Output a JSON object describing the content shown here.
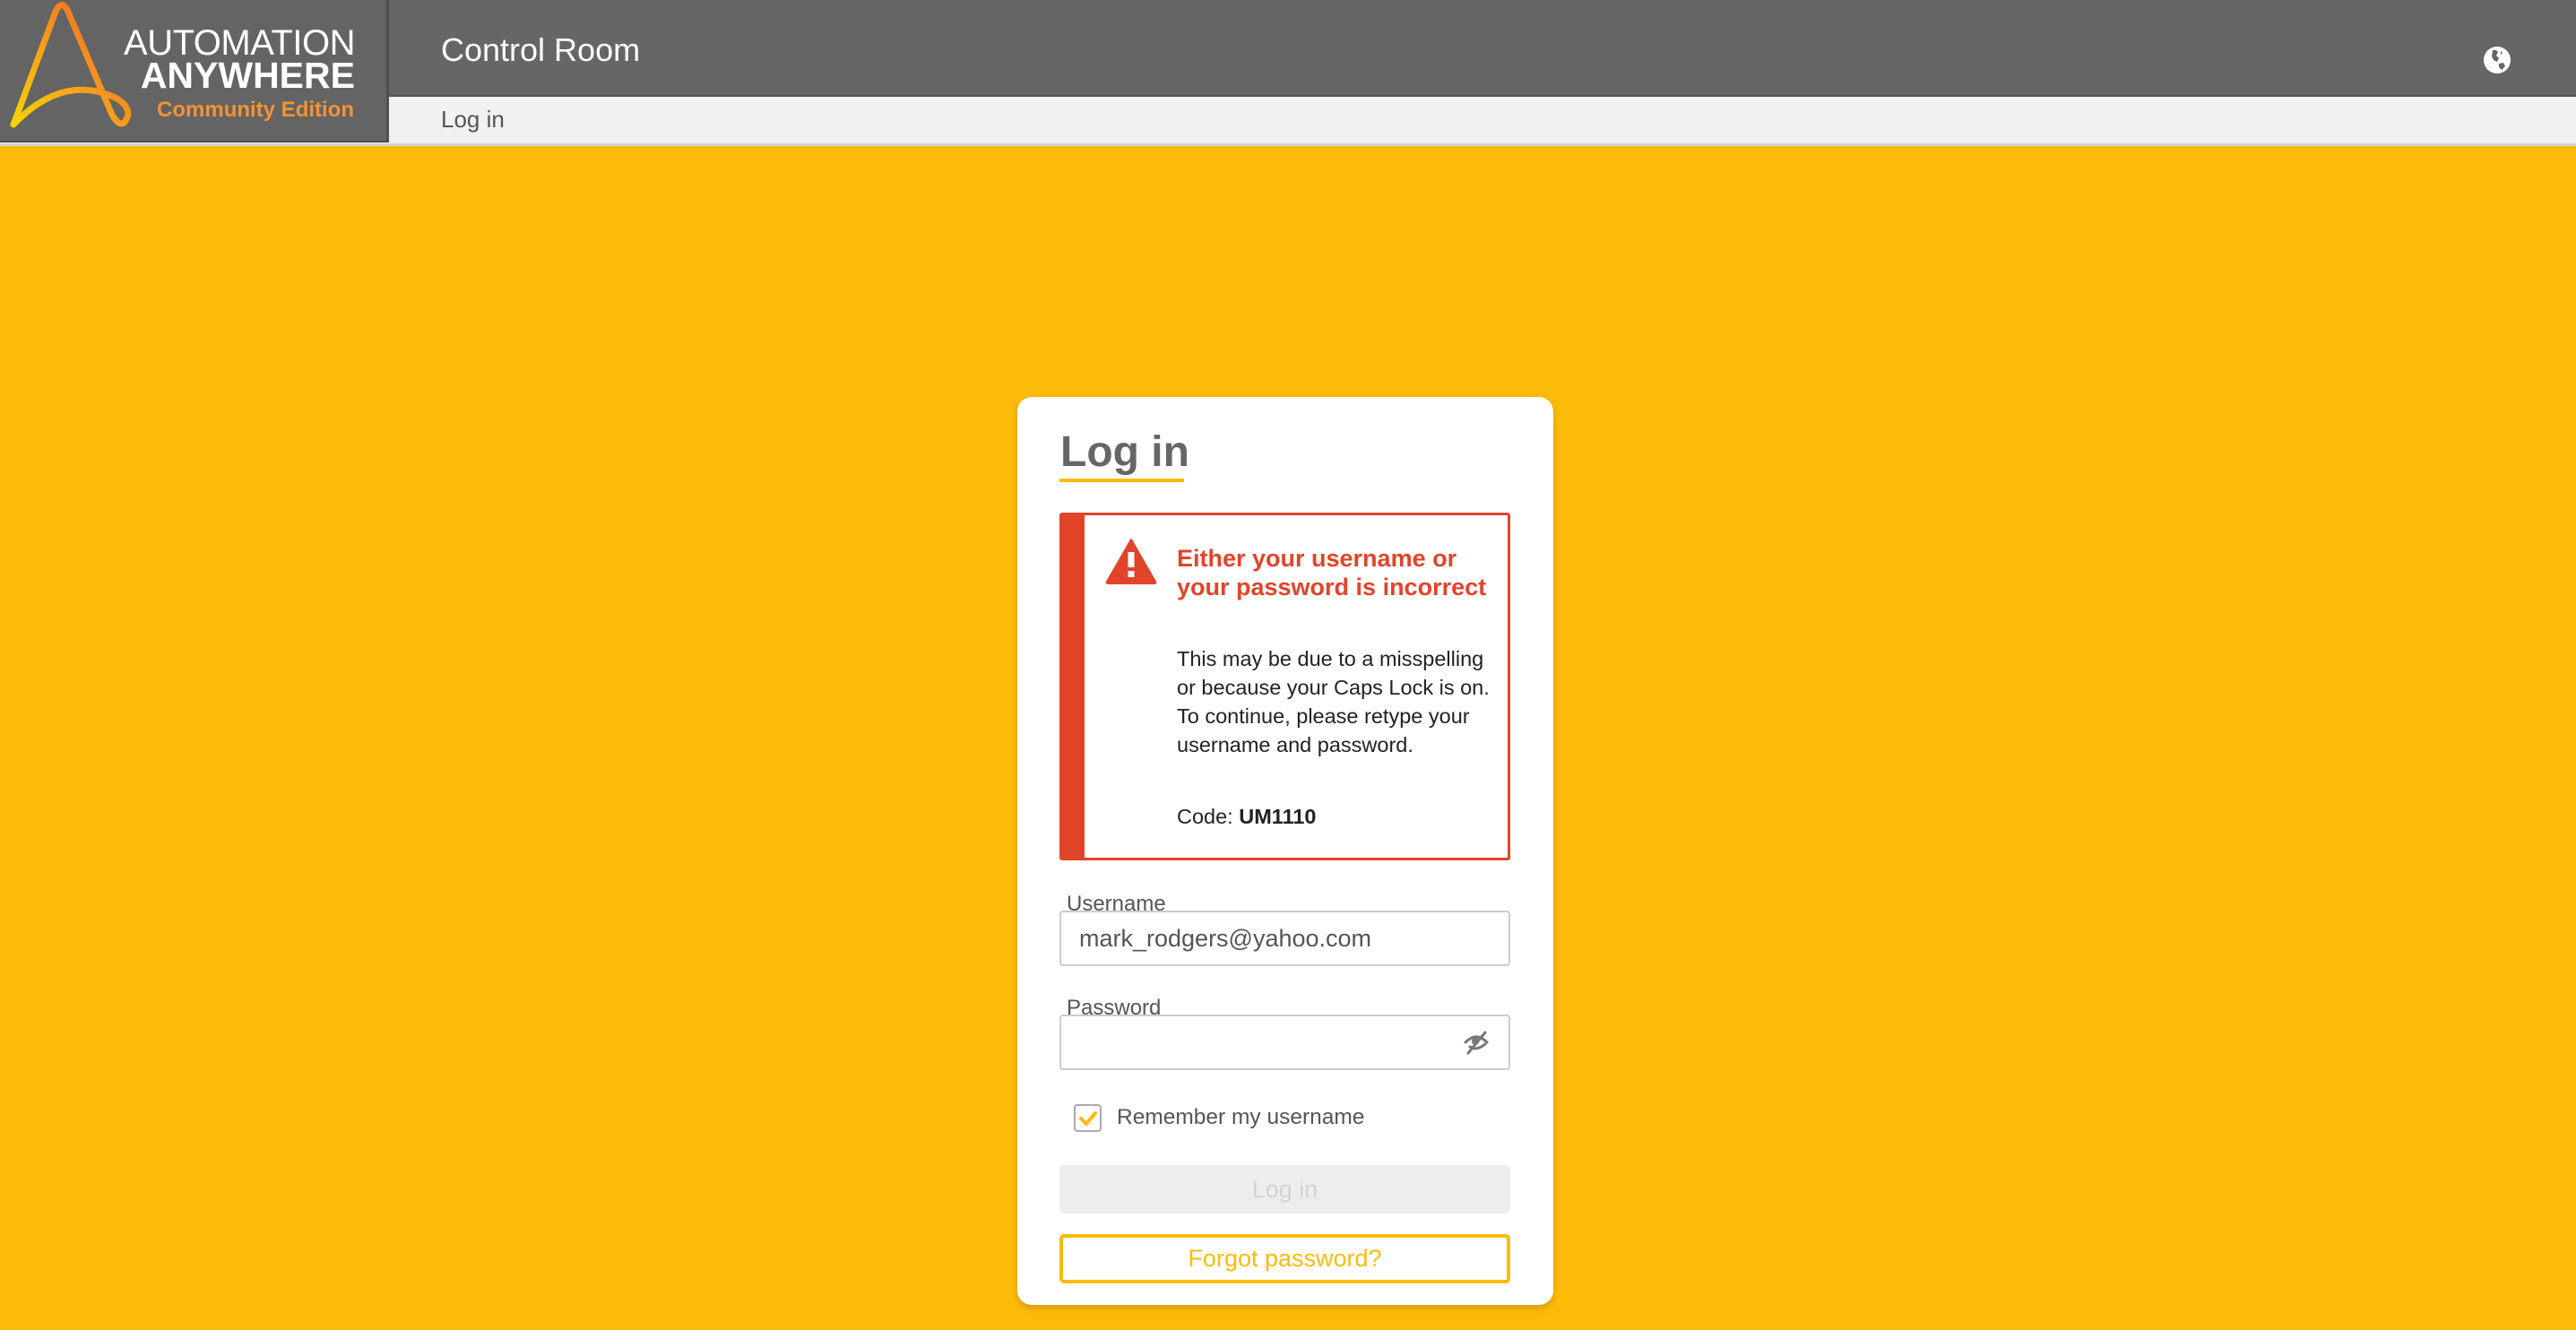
{
  "header": {
    "logo": {
      "line1": "AUTOMATION",
      "line2": "ANYWHERE",
      "line3": "Community Edition",
      "icon": "automation-anywhere-a-logo"
    },
    "app_title": "Control Room",
    "breadcrumb": "Log in",
    "language_icon": "globe-icon"
  },
  "colors": {
    "background": "#FDBB09",
    "header": "#666666",
    "error": "#E2442A",
    "accent": "#FDBB09"
  },
  "login_card": {
    "title": "Log in",
    "alert": {
      "icon": "warning-triangle-icon",
      "title": "Either your username or your password is incorrect",
      "body": "This may be due to a misspelling or because your Caps Lock is on. To continue, please retype your username and password.",
      "code_label": "Code:",
      "code_value": "UM1110"
    },
    "username": {
      "label": "Username",
      "value": "mark_rodgers@yahoo.com"
    },
    "password": {
      "label": "Password",
      "value": "",
      "toggle_icon": "eye-slash-icon"
    },
    "remember": {
      "label": "Remember my username",
      "checked": true
    },
    "login_button": "Log in",
    "login_button_disabled": true,
    "forgot_button": "Forgot password?"
  }
}
